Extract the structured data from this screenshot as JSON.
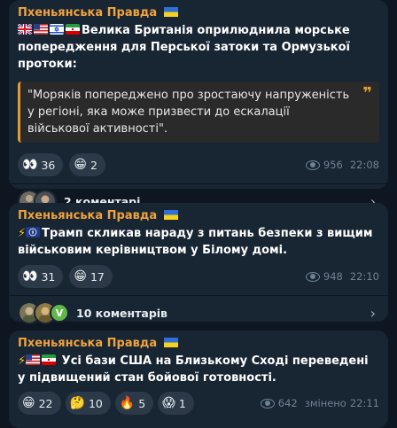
{
  "posts": [
    {
      "channel": "Пхеньянська Правда",
      "text": "Велика Британія оприлюднила морське попередження для Перської затоки та Ормузької протоки:",
      "quote": "\"Моряків попереджено про зростаючу напруженість у регіоні, яка може призвести до ескалації військової активності\".",
      "reactions": [
        {
          "emoji": "👀",
          "count": "36"
        },
        {
          "emoji": "😁",
          "count": "2"
        }
      ],
      "views": "956",
      "time": "22:08",
      "comments": "2 коментарі"
    },
    {
      "channel": "Пхеньянська Правда",
      "text": "Трамп скликав нараду з питань безпеки з вищим військовим керівництвом у Білому домі.",
      "reactions": [
        {
          "emoji": "👀",
          "count": "31"
        },
        {
          "emoji": "😁",
          "count": "17"
        }
      ],
      "views": "948",
      "time": "22:10",
      "comments": "10 коментарів",
      "avatar_badge": "V"
    },
    {
      "channel": "Пхеньянська Правда",
      "text": "Усі бази США на Близькому Сході переведені у підвищений стан бойової готовності.",
      "reactions": [
        {
          "emoji": "😁",
          "count": "22"
        },
        {
          "emoji": "🤔",
          "count": "10"
        },
        {
          "emoji": "🔥",
          "count": "5"
        },
        {
          "emoji": "😱",
          "count": "1"
        }
      ],
      "views": "642",
      "edited": "змінено",
      "time": "22:11"
    }
  ],
  "colors": {
    "bg": "#0e1621",
    "bubble": "#182533",
    "accent": "#f0a33e",
    "reaction_bg": "#2b3948"
  },
  "icons": [
    "ukraine-flag-icon",
    "uk-flag-icon",
    "us-flag-icon",
    "israel-flag-icon",
    "iran-flag-icon",
    "lightning-icon",
    "eye-icon",
    "chevron-right-icon"
  ]
}
